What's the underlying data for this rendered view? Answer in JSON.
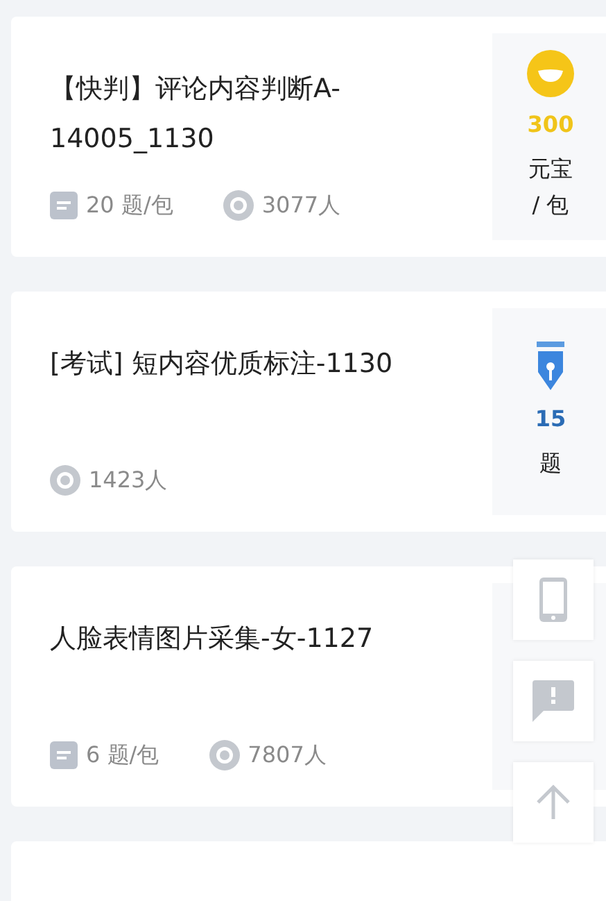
{
  "cards": [
    {
      "title": "【快判】评论内容判断A-14005_1130",
      "meta": [
        {
          "kind": "questions",
          "text": "20 题/包"
        },
        {
          "kind": "views",
          "text": "3077人"
        }
      ],
      "reward": {
        "kind": "coin",
        "amount": "300",
        "unit": "元宝 / 包"
      }
    },
    {
      "title": "[考试] 短内容优质标注-1130",
      "meta": [
        {
          "kind": "views",
          "text": "1423人"
        }
      ],
      "reward": {
        "kind": "pen",
        "amount": "15",
        "unit": "题"
      }
    },
    {
      "title": "人脸表情图片采集-女-1127",
      "meta": [
        {
          "kind": "questions",
          "text": "6 题/包"
        },
        {
          "kind": "views",
          "text": "7807人"
        }
      ]
    },
    {
      "kind": "partial"
    }
  ],
  "float_buttons": [
    {
      "kind": "phone"
    },
    {
      "kind": "feedback"
    },
    {
      "kind": "top"
    }
  ]
}
